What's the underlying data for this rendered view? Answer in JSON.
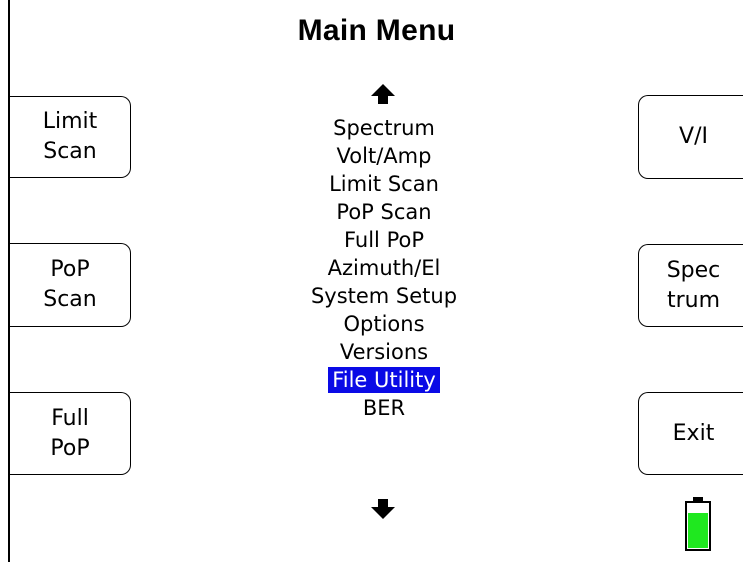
{
  "title": "Main Menu",
  "left_softkeys": [
    {
      "label": "Limit\nScan"
    },
    {
      "label": "PoP\nScan"
    },
    {
      "label": "Full\nPoP"
    }
  ],
  "right_softkeys": [
    {
      "label": "V/I"
    },
    {
      "label": "Spec\ntrum"
    },
    {
      "label": "Exit"
    }
  ],
  "menu": {
    "items": [
      "Spectrum",
      "Volt/Amp",
      "Limit Scan",
      "PoP Scan",
      "Full PoP",
      "Azimuth/El",
      "System Setup",
      "Options",
      "Versions",
      "File Utility",
      "BER"
    ],
    "selected": "File Utility",
    "highlight_color": "#0a0ae6"
  },
  "icons": {
    "scroll_up": "arrow-up-icon",
    "scroll_down": "arrow-down-icon",
    "battery": "battery-icon"
  },
  "battery": {
    "level": 0.8,
    "fill_color": "#1fe81f"
  }
}
